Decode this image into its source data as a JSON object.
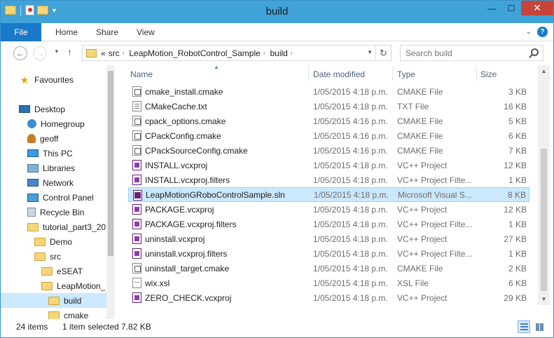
{
  "window": {
    "title": "build"
  },
  "quick_access": {
    "icons": [
      "folder-icon",
      "properties-icon",
      "new-folder-icon"
    ]
  },
  "ribbon": {
    "file_tab": "File",
    "tabs": [
      "Home",
      "Share",
      "View"
    ]
  },
  "window_buttons": {
    "minimize": "—",
    "maximize": "☐",
    "close": "✕"
  },
  "address": {
    "overflow": "«",
    "crumbs": [
      "src",
      "LeapMotion_RobotControl_Sample",
      "build"
    ],
    "separator": "›"
  },
  "search": {
    "placeholder": "Search build"
  },
  "nav_pane": {
    "items": [
      {
        "label": "Favourites",
        "icon": "star-icon"
      },
      {
        "label": "Desktop",
        "icon": "desktop-icon"
      },
      {
        "label": "Homegroup",
        "icon": "homegroup-icon"
      },
      {
        "label": "geoff",
        "icon": "user-folder-icon"
      },
      {
        "label": "This PC",
        "icon": "computer-icon"
      },
      {
        "label": "Libraries",
        "icon": "libraries-icon"
      },
      {
        "label": "Network",
        "icon": "network-icon"
      },
      {
        "label": "Control Panel",
        "icon": "control-panel-icon"
      },
      {
        "label": "Recycle Bin",
        "icon": "recycle-bin-icon"
      },
      {
        "label": "tutorial_part3_20",
        "icon": "folder-icon"
      },
      {
        "label": "Demo",
        "icon": "folder-icon"
      },
      {
        "label": "src",
        "icon": "folder-icon"
      },
      {
        "label": "eSEAT",
        "icon": "folder-icon"
      },
      {
        "label": "LeapMotion_",
        "icon": "folder-icon"
      },
      {
        "label": "build",
        "icon": "folder-icon"
      },
      {
        "label": "cmake",
        "icon": "folder-icon"
      }
    ]
  },
  "columns": {
    "name": "Name",
    "date": "Date modified",
    "type": "Type",
    "size": "Size"
  },
  "files": [
    {
      "name": "cmake_install.cmake",
      "date": "1/05/2015 4:18 p.m.",
      "type": "CMAKE File",
      "size": "3 KB",
      "icon": "cmake-file-icon"
    },
    {
      "name": "CMakeCache.txt",
      "date": "1/05/2015 4:18 p.m.",
      "type": "TXT File",
      "size": "16 KB",
      "icon": "text-file-icon"
    },
    {
      "name": "cpack_options.cmake",
      "date": "1/05/2015 4:16 p.m.",
      "type": "CMAKE File",
      "size": "5 KB",
      "icon": "cmake-file-icon"
    },
    {
      "name": "CPackConfig.cmake",
      "date": "1/05/2015 4:16 p.m.",
      "type": "CMAKE File",
      "size": "6 KB",
      "icon": "cmake-file-icon"
    },
    {
      "name": "CPackSourceConfig.cmake",
      "date": "1/05/2015 4:16 p.m.",
      "type": "CMAKE File",
      "size": "7 KB",
      "icon": "cmake-file-icon"
    },
    {
      "name": "INSTALL.vcxproj",
      "date": "1/05/2015 4:18 p.m.",
      "type": "VC++ Project",
      "size": "12 KB",
      "icon": "vcxproj-icon"
    },
    {
      "name": "INSTALL.vcxproj.filters",
      "date": "1/05/2015 4:18 p.m.",
      "type": "VC++ Project Filte...",
      "size": "1 KB",
      "icon": "vcxproj-filters-icon"
    },
    {
      "name": "LeapMotionGRoboControlSample.sln",
      "date": "1/05/2015 4:18 p.m.",
      "type": "Microsoft Visual S...",
      "size": "8 KB",
      "icon": "solution-icon"
    },
    {
      "name": "PACKAGE.vcxproj",
      "date": "1/05/2015 4:18 p.m.",
      "type": "VC++ Project",
      "size": "12 KB",
      "icon": "vcxproj-icon"
    },
    {
      "name": "PACKAGE.vcxproj.filters",
      "date": "1/05/2015 4:18 p.m.",
      "type": "VC++ Project Filte...",
      "size": "1 KB",
      "icon": "vcxproj-filters-icon"
    },
    {
      "name": "uninstall.vcxproj",
      "date": "1/05/2015 4:18 p.m.",
      "type": "VC++ Project",
      "size": "27 KB",
      "icon": "vcxproj-icon"
    },
    {
      "name": "uninstall.vcxproj.filters",
      "date": "1/05/2015 4:18 p.m.",
      "type": "VC++ Project Filte...",
      "size": "1 KB",
      "icon": "vcxproj-filters-icon"
    },
    {
      "name": "uninstall_target.cmake",
      "date": "1/05/2015 4:18 p.m.",
      "type": "CMAKE File",
      "size": "2 KB",
      "icon": "cmake-file-icon"
    },
    {
      "name": "wix.xsl",
      "date": "1/05/2015 4:18 p.m.",
      "type": "XSL File",
      "size": "6 KB",
      "icon": "xsl-file-icon"
    },
    {
      "name": "ZERO_CHECK.vcxproj",
      "date": "1/05/2015 4:18 p.m.",
      "type": "VC++ Project",
      "size": "29 KB",
      "icon": "vcxproj-icon"
    }
  ],
  "status": {
    "items": "24 items",
    "selection": "1 item selected  7.82 KB"
  },
  "colors": {
    "titlebar": "#3fa3d8",
    "file_tab": "#1979ca",
    "selection": "#cce8ff",
    "close": "#c7443a"
  }
}
